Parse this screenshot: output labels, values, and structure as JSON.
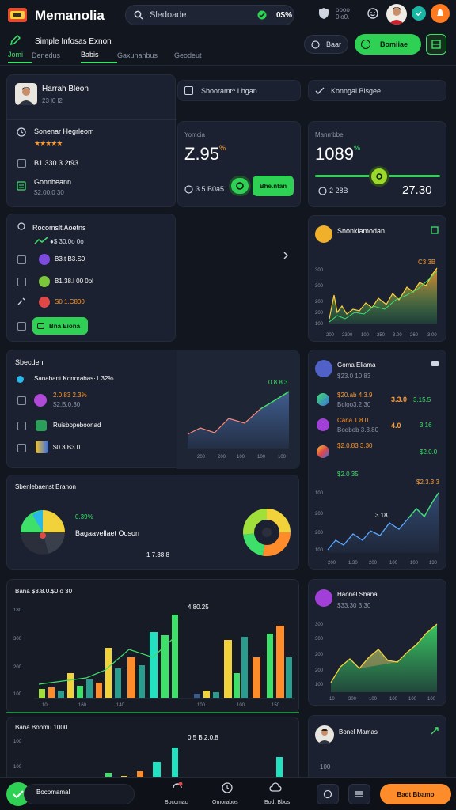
{
  "app": {
    "title": "Memanolia",
    "search_placeholder": "Sledoade",
    "search_badge": "0$%",
    "top_right_badge_1": "oooo\n0lo0.",
    "subtitle": "Simple Infosas Exnon"
  },
  "tabs": [
    {
      "label": "Jomi"
    },
    {
      "label": "Denedus"
    },
    {
      "label": "Babis"
    },
    {
      "label": "Gaxunanbus"
    },
    {
      "label": "Geodeut"
    }
  ],
  "toolbar": {
    "secondary_label": "Baar",
    "primary_label": "Bomiiae"
  },
  "profile_card": {
    "name": "Harrah Bleon",
    "sub": "23 l0 l2",
    "items": [
      {
        "label": "Sonenar Hegrleom",
        "value": "★★★★★"
      },
      {
        "label": "B1.330 3.2t93",
        "value": ""
      },
      {
        "label": "Gonnbeann",
        "value": "$2.00.0 30"
      }
    ]
  },
  "filter_left": {
    "label": "Sbooramt^ Lhgan"
  },
  "filter_right": {
    "label": "Konngal Bisgee"
  },
  "stat_left": {
    "label": "Yomcia",
    "value": "Z.95",
    "unit": "%",
    "foot": "3.5 B0a5",
    "button": "Bhe.ntan"
  },
  "stat_right": {
    "label": "Manmbbe",
    "value": "1089",
    "unit": "%",
    "foot": "2 28B",
    "value2": "27.30"
  },
  "tasks_card": {
    "title": "Rocomslt Aoetns",
    "items": [
      {
        "label": "●$ 30.0o 0o",
        "color": "#3ee06a"
      },
      {
        "label": "B3.t B3.S0",
        "color": "#d7dce6"
      },
      {
        "label": "B1.38.l 00 0ol",
        "color": "#d7dce6"
      },
      {
        "label": "S0 1.C800",
        "color": "#ff9a2e"
      }
    ],
    "button": "Bna Eiona"
  },
  "chart_right_top": {
    "title": "Snonklamodan",
    "badge": "C3.3B",
    "y_ticks": [
      "300",
      "300",
      "200",
      "200",
      "100"
    ],
    "x_ticks": [
      "200",
      "2300",
      "100",
      "250",
      "3.00",
      "260",
      "3.00"
    ]
  },
  "mid_left_card": {
    "title": "Sbecden",
    "items": [
      {
        "label": "Sanabant Konnrabas·1.32%",
        "sub": ""
      },
      {
        "label": "2.0.83 2.3%",
        "sub": "$2.B.0.30"
      },
      {
        "label": "Ruisbopeboonad",
        "sub": ""
      },
      {
        "label": "$0.3.B3.0",
        "sub": ""
      }
    ],
    "area_badge": "0.8.8.3",
    "area_x_ticks": [
      "200",
      "200",
      "100",
      "100",
      "100"
    ]
  },
  "right_list_card": {
    "title": "Goma Eliama",
    "sub": "$23.0 10 83",
    "rows": [
      {
        "a": "$20.ab 4.3.9",
        "b": "Bcloo3.2.30",
        "c": "3.3.0",
        "d": "3.15.5"
      },
      {
        "a": "Cana 1.8.0",
        "b": "Bodbeb 3.3.80",
        "c": "4.0",
        "d": "3.16"
      },
      {
        "a": "$2.0.83 3.30",
        "b": " ",
        "c": "",
        "d": "$2.0.0"
      }
    ],
    "foot": "$2.0 35",
    "right_badge": "$2.3.3.3"
  },
  "pie_card": {
    "title": "Sbenlebaenst Branon",
    "pct": "0.39%",
    "label": "Bagaavellaet Ooson",
    "value": "1 7.38.8"
  },
  "right_line_card": {
    "badge": "3.18",
    "y_ticks": [
      "100",
      "200",
      "200",
      "100"
    ],
    "x_ticks": [
      "200",
      "1.30",
      "200",
      "100",
      "100",
      "130"
    ]
  },
  "bar_card": {
    "title": "Bana $3.8.0.$0.o 30",
    "badge": "4.80.25",
    "y_ticks": [
      "180",
      "300",
      "200",
      "100"
    ],
    "x_ticks": [
      "10",
      "160",
      "140",
      "100",
      "100",
      "150"
    ]
  },
  "right_area_card": {
    "title": "Haonel Sbana",
    "sub": "$33.30 3.30",
    "y_ticks": [
      "300",
      "300",
      "200",
      "200",
      "100"
    ],
    "x_ticks": [
      "10",
      "300",
      "100",
      "100",
      "100",
      "100"
    ]
  },
  "bar_card2": {
    "title": "Bana Bonmu 1000",
    "y_ticks": [
      "100",
      "100"
    ],
    "badge": "0.5 B.2.0.8"
  },
  "right_profile_card": {
    "name": "Bonel Mamas",
    "y_ticks": [
      "100",
      "100"
    ]
  },
  "bottom_bar": {
    "label": "Bocomamal",
    "sub": "$3.3B 8.0l",
    "nav": [
      {
        "label": "Bocomac"
      },
      {
        "label": "Omorabos"
      },
      {
        "label": "Bodt Bbos"
      }
    ],
    "cta": "Badt Bbamo"
  }
}
